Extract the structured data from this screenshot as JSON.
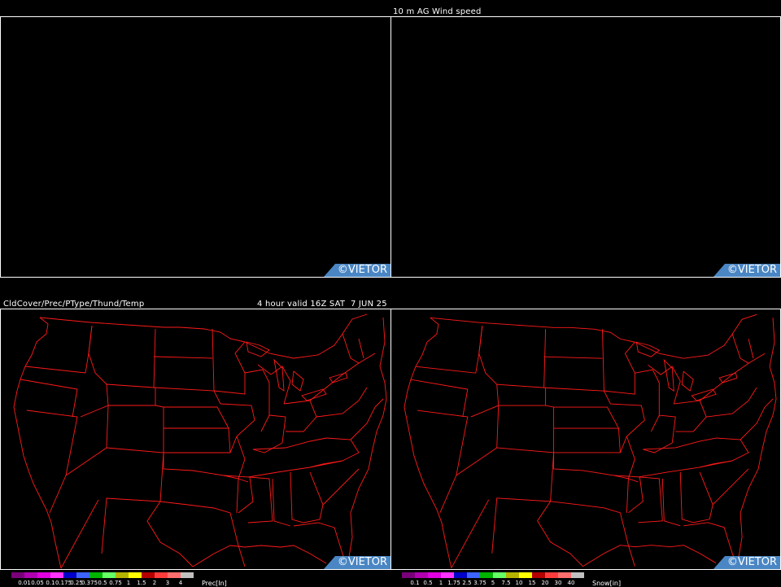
{
  "top_title": "10 m AG Wind speed",
  "bottom_left_title": "CldCover/Prec/PType/Thund/Temp",
  "bottom_right_title": "4 hour valid 16Z SAT  7 JUN 25",
  "watermark": "©VIETOR",
  "map_line_color": "#ff1a1a",
  "badge_color": "#4a86c4",
  "precip_legend": {
    "colors": [
      "#7a007a",
      "#b000b0",
      "#e000e0",
      "#ff33ff",
      "#0000c8",
      "#3d64ff",
      "#00b400",
      "#66ff66",
      "#b4b400",
      "#ffff00",
      "#b40000",
      "#ff3c3c",
      "#ff6e6e",
      "#c0c0c0"
    ],
    "ticks": [
      "0.01",
      "0.05",
      "0.1",
      "0.175",
      "0.25",
      "0.375",
      "0.5",
      "0.75",
      "1",
      "1.5",
      "2",
      "3",
      "4"
    ],
    "unit": "Prec[In]"
  },
  "snow_legend": {
    "colors": [
      "#7a007a",
      "#b000b0",
      "#e000e0",
      "#ff33ff",
      "#0000c8",
      "#3d64ff",
      "#00b400",
      "#66ff66",
      "#b4b400",
      "#ffff00",
      "#b40000",
      "#ff3c3c",
      "#ff6e6e",
      "#c0c0c0"
    ],
    "ticks": [
      "0.1",
      "0.5",
      "1",
      "1.75",
      "2.5",
      "3.75",
      "5",
      "7.5",
      "10",
      "15",
      "20",
      "30",
      "40"
    ],
    "unit": "Snow[in]"
  }
}
